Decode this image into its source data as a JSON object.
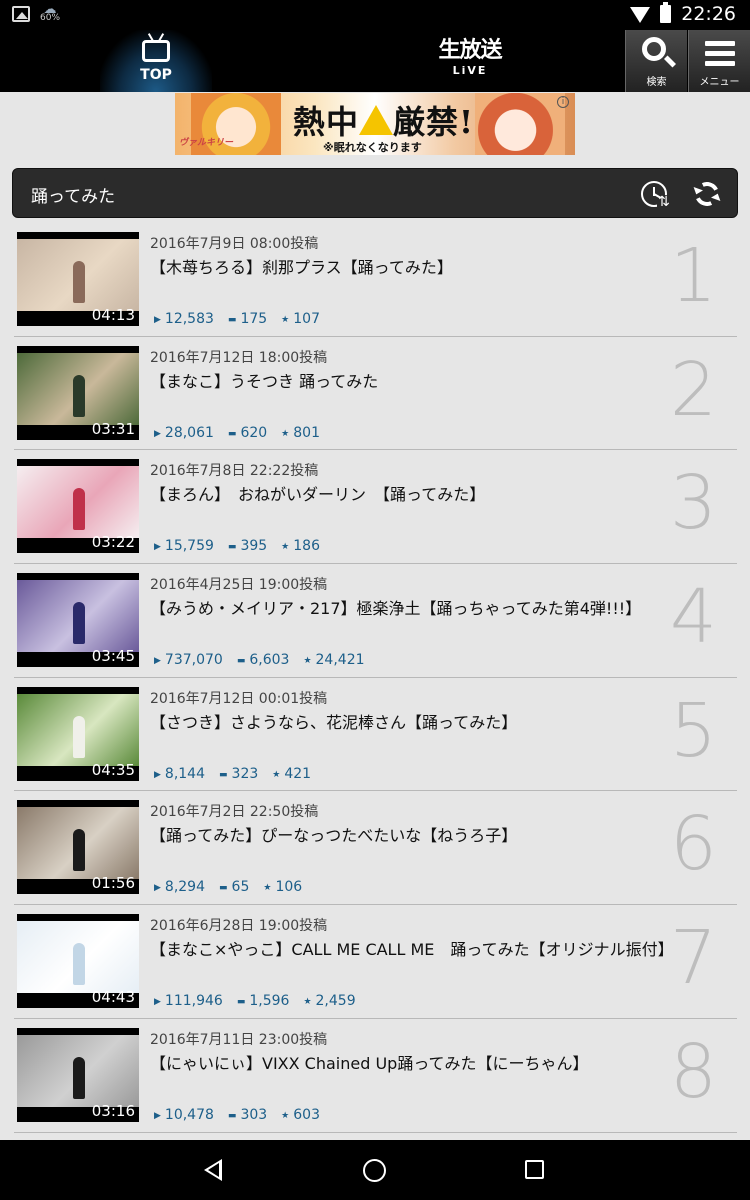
{
  "status_bar": {
    "battery_percent": "60%",
    "time": "22:26"
  },
  "header": {
    "top_label": "TOP",
    "live_line1": "生放送",
    "live_line2": "LiVE",
    "search_label": "検索",
    "menu_label": "メニュー"
  },
  "ad": {
    "headline": "熱中",
    "headline2": "厳禁!",
    "subtext": "※眠れなくなります",
    "logo": "ヴァルキリー",
    "info": "i"
  },
  "category": {
    "title": "踊ってみた"
  },
  "videos": [
    {
      "date": "2016年7月9日 08:00投稿",
      "title": "【木苺ちろる】刹那プラス【踊ってみた】",
      "duration": "04:13",
      "views": "12,583",
      "comments": "175",
      "mylists": "107",
      "rank": "1",
      "colors": [
        "#c8b6a4",
        "#e8d8c4",
        "#8a6a5a"
      ]
    },
    {
      "date": "2016年7月12日 18:00投稿",
      "title": "【まなこ】うそつき 踊ってみた",
      "duration": "03:31",
      "views": "28,061",
      "comments": "620",
      "mylists": "801",
      "rank": "2",
      "colors": [
        "#4d6a3a",
        "#c9b89a",
        "#2a3a2a"
      ]
    },
    {
      "date": "2016年7月8日 22:22投稿",
      "title": "【まろん】　おねがいダーリン　【踊ってみた】",
      "duration": "03:22",
      "views": "15,759",
      "comments": "395",
      "mylists": "186",
      "rank": "3",
      "colors": [
        "#f5eef0",
        "#e9a6b8",
        "#c0304a"
      ]
    },
    {
      "date": "2016年4月25日 19:00投稿",
      "title": "【みうめ・メイリア・217】極楽浄土【踊っちゃってみた第4弾!!!】",
      "duration": "03:45",
      "views": "737,070",
      "comments": "6,603",
      "mylists": "24,421",
      "rank": "4",
      "colors": [
        "#6a5a9a",
        "#c8c0e0",
        "#2a2a6a"
      ]
    },
    {
      "date": "2016年7月12日 00:01投稿",
      "title": "【さつき】さようなら、花泥棒さん【踊ってみた】",
      "duration": "04:35",
      "views": "8,144",
      "comments": "323",
      "mylists": "421",
      "rank": "5",
      "colors": [
        "#5a8a3a",
        "#d8e6c0",
        "#f0f0ea"
      ]
    },
    {
      "date": "2016年7月2日 22:50投稿",
      "title": "【踊ってみた】ぴーなっつたべたいな【ねうろ子】",
      "duration": "01:56",
      "views": "8,294",
      "comments": "65",
      "mylists": "106",
      "rank": "6",
      "colors": [
        "#8a7a6a",
        "#d8d0c4",
        "#1a1a1a"
      ]
    },
    {
      "date": "2016年6月28日 19:00投稿",
      "title": "【まなこ×やっこ】CALL ME CALL ME　踊ってみた【オリジナル振付】",
      "duration": "04:43",
      "views": "111,946",
      "comments": "1,596",
      "mylists": "2,459",
      "rank": "7",
      "colors": [
        "#e6eef5",
        "#ffffff",
        "#c2d6e6"
      ]
    },
    {
      "date": "2016年7月11日 23:00投稿",
      "title": "【にゃいにぃ】VIXX  Chained Up踊ってみた【にーちゃん】",
      "duration": "03:16",
      "views": "10,478",
      "comments": "303",
      "mylists": "603",
      "rank": "8",
      "colors": [
        "#9a9a9a",
        "#d0d0d0",
        "#1a1a1a"
      ]
    }
  ]
}
